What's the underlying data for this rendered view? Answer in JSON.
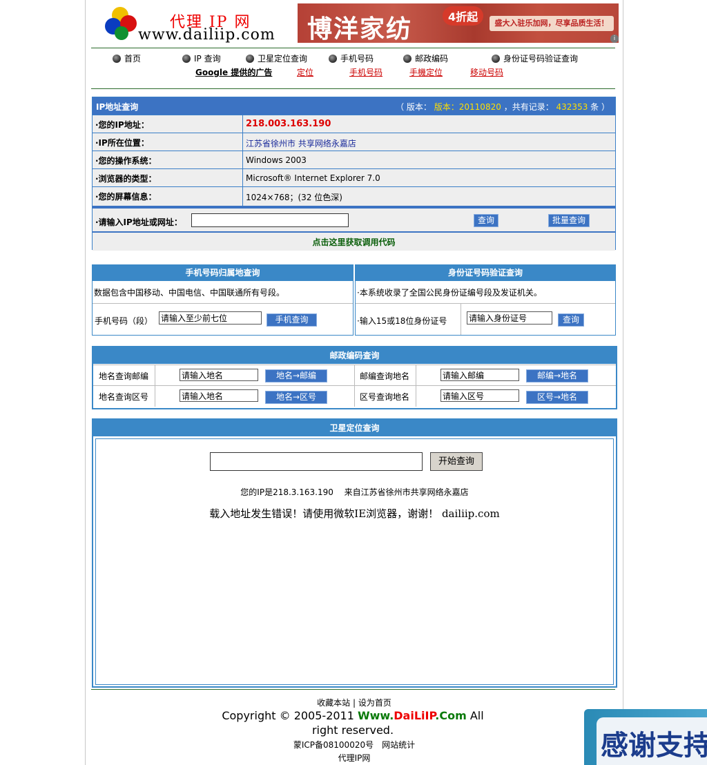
{
  "header": {
    "logo_title": "代理 IP 网",
    "logo_url": "www.dailiip.com",
    "banner_text": "博洋家纺",
    "banner_badge": "4折起",
    "banner_slogan": "盛大入驻乐加网，尽享品质生活！",
    "banner_info": "i"
  },
  "nav": {
    "items": [
      "首页",
      "IP 查询",
      "卫星定位查询",
      "手机号码",
      "邮政编码",
      "身份证号码验证查询"
    ]
  },
  "ads": {
    "google": "Google 提供的广告",
    "links": [
      "定位",
      "手机号码",
      "手機定位",
      "移动号码"
    ]
  },
  "ip": {
    "title": "IP地址查询",
    "version_prefix": "（ 版本：",
    "version": "版本：20110820",
    "records_prefix": "，共有记录：",
    "records": "432353",
    "records_suffix": "条 ）",
    "rows": [
      {
        "label": "·您的IP地址：",
        "value": "218.003.163.190"
      },
      {
        "label": "·IP所在位置：",
        "value": "江苏省徐州市 共享网络永嘉店"
      },
      {
        "label": "·您的操作系统：",
        "value": "Windows 2003"
      },
      {
        "label": "·浏览器的类型：",
        "value": "Microsoft® Internet Explorer 7.0"
      },
      {
        "label": "·您的屏幕信息：",
        "value": "1024×768；(32 位色深)"
      }
    ],
    "input_label": "·请输入IP地址或网址：",
    "query_btn": "查询",
    "batch_btn": "批量查询",
    "code_link": "点击这里获取调用代码"
  },
  "phone": {
    "title": "手机号码归属地查询",
    "desc": "数据包含中国移动、中国电信、中国联通所有号段。",
    "label": "手机号码（段）",
    "placeholder": "请输入至少前七位",
    "btn": "手机查询"
  },
  "idcard": {
    "title": "身份证号码验证查询",
    "desc": "·本系统收录了全国公民身份证编号段及发证机关。",
    "label": "·输入15或18位身份证号",
    "placeholder": "请输入身份证号",
    "btn": "查询"
  },
  "post": {
    "title": "邮政编码查询",
    "rows": [
      [
        {
          "label": "地名查询邮编",
          "placeholder": "请输入地名",
          "btn": "地名→邮编"
        },
        {
          "label": "邮编查询地名",
          "placeholder": "请输入邮编",
          "btn": "邮编→地名"
        }
      ],
      [
        {
          "label": "地名查询区号",
          "placeholder": "请输入地名",
          "btn": "地名→区号"
        },
        {
          "label": "区号查询地名",
          "placeholder": "请输入区号",
          "btn": "区号→地名"
        }
      ]
    ]
  },
  "gps": {
    "title": "卫星定位查询",
    "start_btn": "开始查询",
    "ip_line": "您的IP是218.3.163.190 　来自江苏省徐州市共享网络永嘉店",
    "error": "载入地址发生错误！请使用微软IE浏览器，谢谢！ dailiip.com"
  },
  "footer": {
    "fav": "收藏本站",
    "sep": "|",
    "home": "设为首页",
    "copyright_pre": "Copyright © 2005-2011 ",
    "brand_www": "Www.",
    "brand_mid": "DaiLiIP",
    "brand_com": ".Com",
    "copyright_post": " All right reserved.",
    "icp": "蒙ICP备08100020号",
    "stats": "网站统计",
    "site": "代理IP网"
  },
  "thanks": {
    "text": "感谢支持"
  },
  "colors": {
    "accent_blue": "#3c73c3",
    "header_blue": "#3a88c7",
    "link_red": "#c00",
    "green": "#0a5e0a"
  }
}
